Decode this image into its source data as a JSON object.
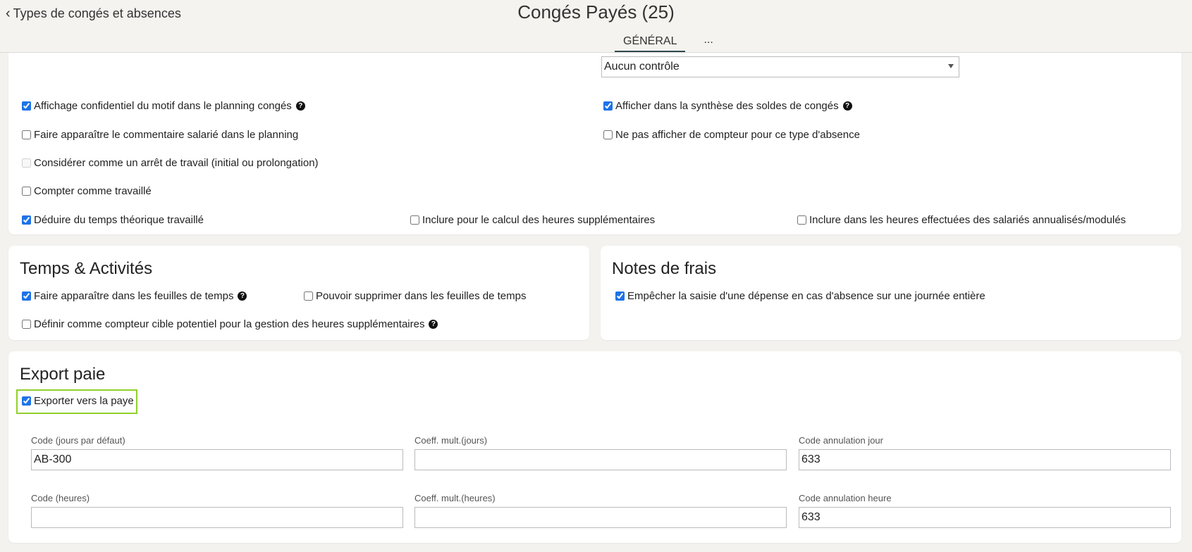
{
  "header": {
    "back_label": "Types de congés et absences",
    "title": "Congés Payés (25)",
    "tabs": [
      "GÉNÉRAL",
      "..."
    ]
  },
  "general": {
    "select_value": "Aucun contrôle",
    "checkboxes": [
      {
        "label": "Affichage confidentiel du motif dans le planning congés",
        "checked": true,
        "help": true
      },
      {
        "label": "Afficher dans la synthèse des soldes de congés",
        "checked": true,
        "help": true
      },
      {
        "label": "Faire apparaître le commentaire salarié dans le planning",
        "checked": false
      },
      {
        "label": "Ne pas afficher de compteur pour ce type d'absence",
        "checked": false
      },
      {
        "label": "Considérer comme un arrêt de travail (initial ou prolongation)",
        "checked": false,
        "disabled": true
      },
      {
        "label": "Compter comme travaillé",
        "checked": false
      },
      {
        "label": "Déduire du temps théorique travaillé",
        "checked": true
      },
      {
        "label": "Inclure pour le calcul des heures supplémentaires",
        "checked": false
      },
      {
        "label": "Inclure dans les heures effectuées des salariés annualisés/modulés",
        "checked": false
      }
    ]
  },
  "temps": {
    "title": "Temps & Activités",
    "checkboxes": [
      {
        "label": "Faire apparaître dans les feuilles de temps",
        "checked": true,
        "help": true
      },
      {
        "label": "Pouvoir supprimer dans les feuilles de temps",
        "checked": false
      },
      {
        "label": "Définir comme compteur cible potentiel pour la gestion des heures supplémentaires",
        "checked": false,
        "help": true
      }
    ]
  },
  "frais": {
    "title": "Notes de frais",
    "checkboxes": [
      {
        "label": "Empêcher la saisie d'une dépense en cas d'absence sur une journée entière",
        "checked": true
      }
    ]
  },
  "export": {
    "title": "Export paie",
    "export_checkbox": {
      "label": "Exporter vers la paye",
      "checked": true
    },
    "fields": [
      {
        "label": "Code (jours par défaut)",
        "value": "AB-300"
      },
      {
        "label": "Coeff. mult.(jours)",
        "value": ""
      },
      {
        "label": "Code annulation jour",
        "value": "633"
      },
      {
        "label": "Code (heures)",
        "value": ""
      },
      {
        "label": "Coeff. mult.(heures)",
        "value": ""
      },
      {
        "label": "Code annulation heure",
        "value": "633"
      }
    ]
  }
}
